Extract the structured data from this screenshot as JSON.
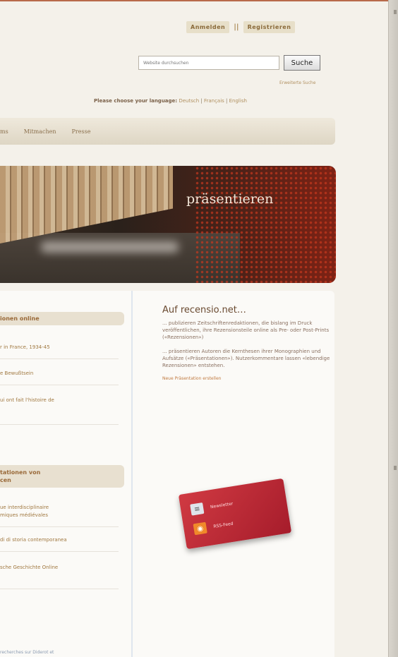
{
  "header": {
    "login_label": "Anmelden",
    "separator": "||",
    "register_label": "Registrieren"
  },
  "search": {
    "placeholder": "Website durchsuchen",
    "button_label": "Suche",
    "advanced_label": "Erweiterte Suche"
  },
  "language": {
    "prompt": "Please choose your language:",
    "options": [
      "Deutsch",
      "Français",
      "English"
    ]
  },
  "nav": {
    "items": [
      "ms",
      "Mitmachen",
      "Presse"
    ]
  },
  "banner": {
    "title": "präsentieren"
  },
  "left": {
    "section1_title": "ionen online",
    "section1_items": [
      "r in France, 1934-45",
      "e Bewußtsein",
      "ui ont fait l'histoire de"
    ],
    "section2_title": "tationen von\ncen",
    "section2_items": [
      "ue interdisciplinaire\nmiques médiévales",
      "di di storia contemporanea",
      "sche Geschichte Online"
    ],
    "footer_text": "recherches sur Diderot et"
  },
  "right": {
    "heading": "Auf recensio.net…",
    "para1": "... publizieren Zeitschriftenredaktionen, die bislang im Druck veröffentlichen, ihre Rezensionsteile online als Pre- oder Post-Prints («Rezensionen»)",
    "para2": "... präsentieren Autoren die Kernthesen ihrer Monographien und Aufsätze («Präsentationen»). Nutzerkommentare lassen «lebendige Rezensionen» entstehen.",
    "cta": "Neue Präsentation erstellen"
  },
  "card": {
    "newsletter_label": "Newsletter",
    "rss_label": "RSS-Feed"
  }
}
